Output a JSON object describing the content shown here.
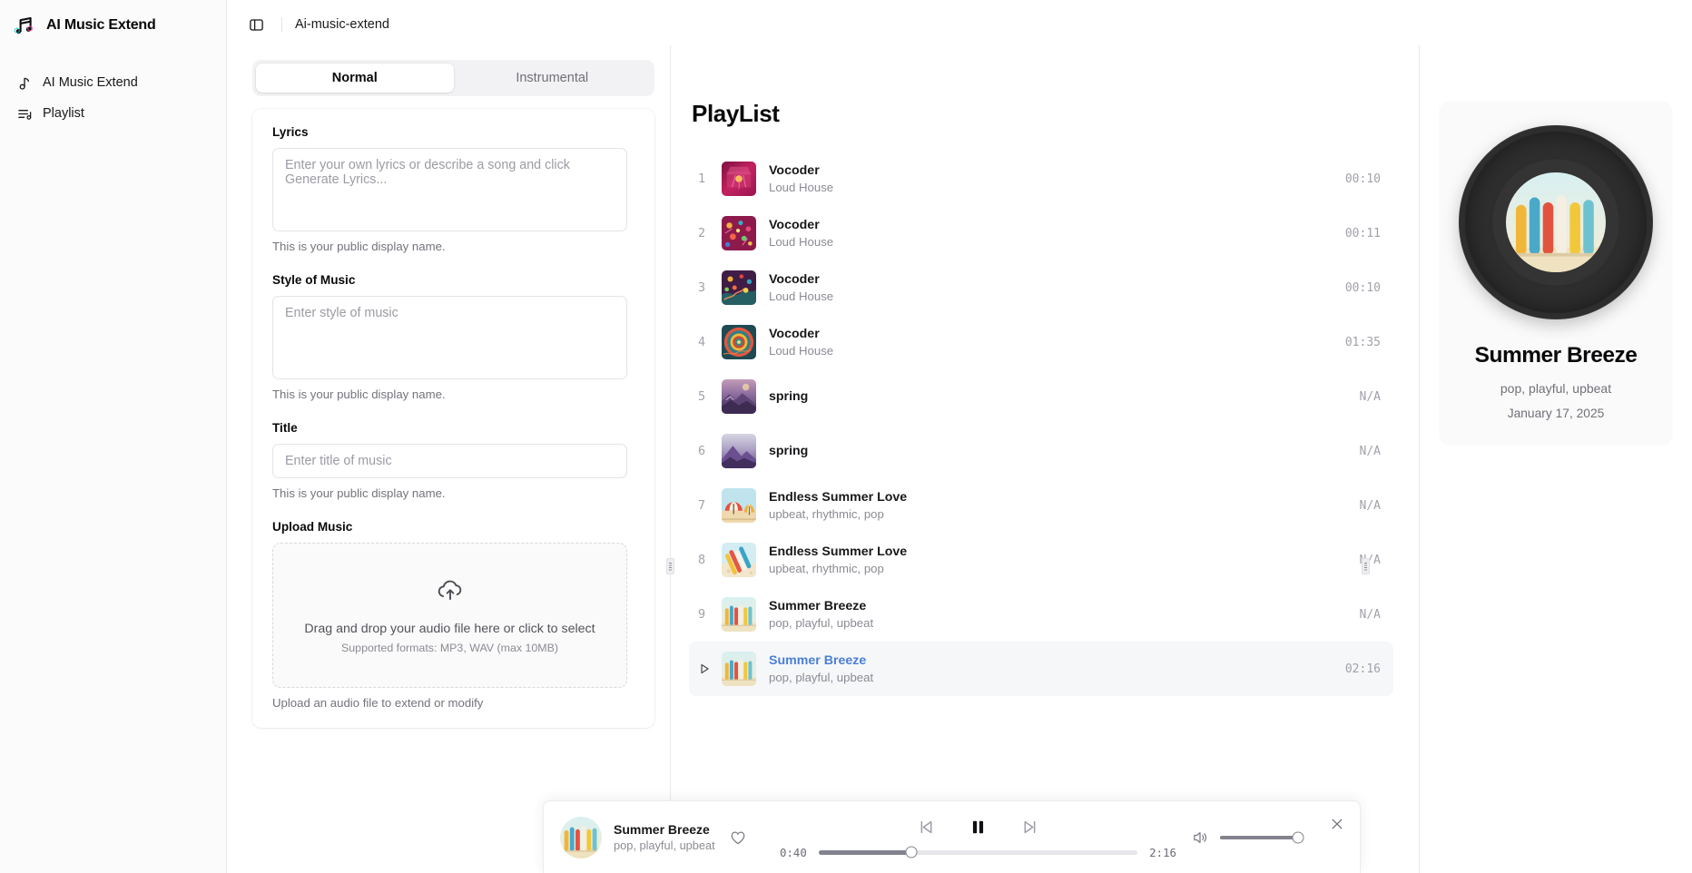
{
  "app": {
    "brand": "AI Music Extend",
    "logo_icon": "music-notes-icon",
    "breadcrumb": "Ai-music-extend",
    "panel_toggle_icon": "sidebar-toggle-icon"
  },
  "sidebar": {
    "items": [
      {
        "label": "AI Music Extend",
        "icon": "music-note-icon"
      },
      {
        "label": "Playlist",
        "icon": "playlist-icon"
      }
    ]
  },
  "form": {
    "tabs": [
      {
        "label": "Normal",
        "active": true
      },
      {
        "label": "Instrumental",
        "active": false
      }
    ],
    "fields": [
      {
        "label": "Lyrics",
        "placeholder": "Enter your own lyrics or describe a song and click Generate Lyrics...",
        "value": "",
        "help": "This is your public display name."
      },
      {
        "label": "Style of Music",
        "placeholder": "Enter style of music",
        "value": "",
        "help": "This is your public display name."
      },
      {
        "label": "Title",
        "placeholder": "Enter title of music",
        "value": "",
        "help": "This is your public display name."
      }
    ],
    "upload": {
      "label": "Upload Music",
      "icon": "cloud-upload-icon",
      "main_text": "Drag and drop your audio file here or click to select",
      "sub_text": "Supported formats: MP3, WAV (max 10MB)",
      "help": "Upload an audio file to extend or modify"
    }
  },
  "playlist": {
    "title": "PlayList",
    "tracks": [
      {
        "index": "1",
        "name": "Vocoder",
        "sub": "Loud House",
        "duration": "00:10",
        "art": "art-magenta-crystal",
        "active": false
      },
      {
        "index": "2",
        "name": "Vocoder",
        "sub": "Loud House",
        "duration": "00:11",
        "art": "art-confetti-pink",
        "active": false
      },
      {
        "index": "3",
        "name": "Vocoder",
        "sub": "Loud House",
        "duration": "00:10",
        "art": "art-confetti-rainbow",
        "active": false
      },
      {
        "index": "4",
        "name": "Vocoder",
        "sub": "Loud House",
        "duration": "01:35",
        "art": "art-radial-target",
        "active": false
      },
      {
        "index": "5",
        "name": "spring",
        "sub": "",
        "duration": "N/A",
        "art": "art-purple-mountain-a",
        "active": false
      },
      {
        "index": "6",
        "name": "spring",
        "sub": "",
        "duration": "N/A",
        "art": "art-purple-mountain-b",
        "active": false
      },
      {
        "index": "7",
        "name": "Endless Summer Love",
        "sub": "upbeat, rhythmic, pop",
        "duration": "N/A",
        "art": "art-beach-umbrella",
        "active": false
      },
      {
        "index": "8",
        "name": "Endless Summer Love",
        "sub": "upbeat, rhythmic, pop",
        "duration": "N/A",
        "art": "art-surfboards-sand",
        "active": false
      },
      {
        "index": "9",
        "name": "Summer Breeze",
        "sub": "pop, playful, upbeat",
        "duration": "N/A",
        "art": "art-surfboards-row",
        "active": false
      },
      {
        "index": "",
        "name": "Summer Breeze",
        "sub": "pop, playful, upbeat",
        "duration": "02:16",
        "art": "art-surfboards-row",
        "active": true,
        "play_icon": "play-triangle-icon"
      }
    ]
  },
  "detail": {
    "title": "Summer Breeze",
    "tags": "pop, playful, upbeat",
    "date": "January 17, 2025",
    "art": "art-surfboards-row"
  },
  "player": {
    "title": "Summer Breeze",
    "subtitle": "pop, playful, upbeat",
    "like_icon": "heart-icon",
    "prev_icon": "skip-back-icon",
    "play_pause_icon": "pause-icon",
    "next_icon": "skip-forward-icon",
    "current_time": "0:40",
    "total_time": "2:16",
    "progress_percent": 29,
    "volume_icon": "volume-icon",
    "volume_percent": 100,
    "close_icon": "close-icon"
  },
  "colors": {
    "accent": "#4a7fd4",
    "text": "#18181b",
    "muted": "#8b8b94",
    "border": "#e9e9ec",
    "surface": "#fafafa"
  }
}
